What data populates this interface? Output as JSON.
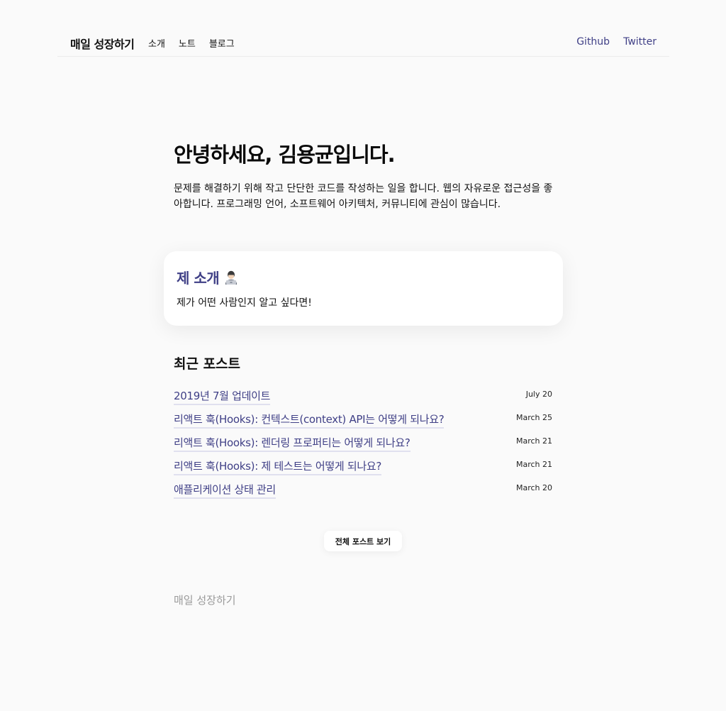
{
  "header": {
    "brand": "매일 성장하기",
    "nav": [
      "소개",
      "노트",
      "블로그"
    ],
    "external": [
      "Github",
      "Twitter"
    ]
  },
  "hero": {
    "title": "안녕하세요, 김용균입니다.",
    "description": "문제를 해결하기 위해 작고 단단한 코드를 작성하는 일을 합니다. 웹의 자유로운 접근성을 좋아합니다. 프로그래밍 언어, 소프트웨어 아키텍처, 커뮤니티에 관심이 많습니다."
  },
  "intro_card": {
    "title": "제 소개",
    "icon": "technologist-emoji-icon",
    "description": "제가 어떤 사람인지 알고 싶다면!"
  },
  "recent": {
    "title": "최근 포스트",
    "posts": [
      {
        "title": "2019년 7월 업데이트",
        "date": "July 20"
      },
      {
        "title": "리액트 훅(Hooks): 컨텍스트(context) API는 어떻게 되나요?",
        "date": "March 25"
      },
      {
        "title": "리액트 훅(Hooks): 렌더링 프로퍼티는 어떻게 되나요?",
        "date": "March 21"
      },
      {
        "title": "리액트 훅(Hooks): 제 테스트는 어떻게 되나요?",
        "date": "March 21"
      },
      {
        "title": "애플리케이션 상태 관리",
        "date": "March 20"
      }
    ],
    "all_button": "전체 포스트 보기"
  },
  "footer": {
    "text": "매일 성장하기"
  },
  "colors": {
    "accent": "#3f3f86",
    "background": "#fafafa"
  }
}
